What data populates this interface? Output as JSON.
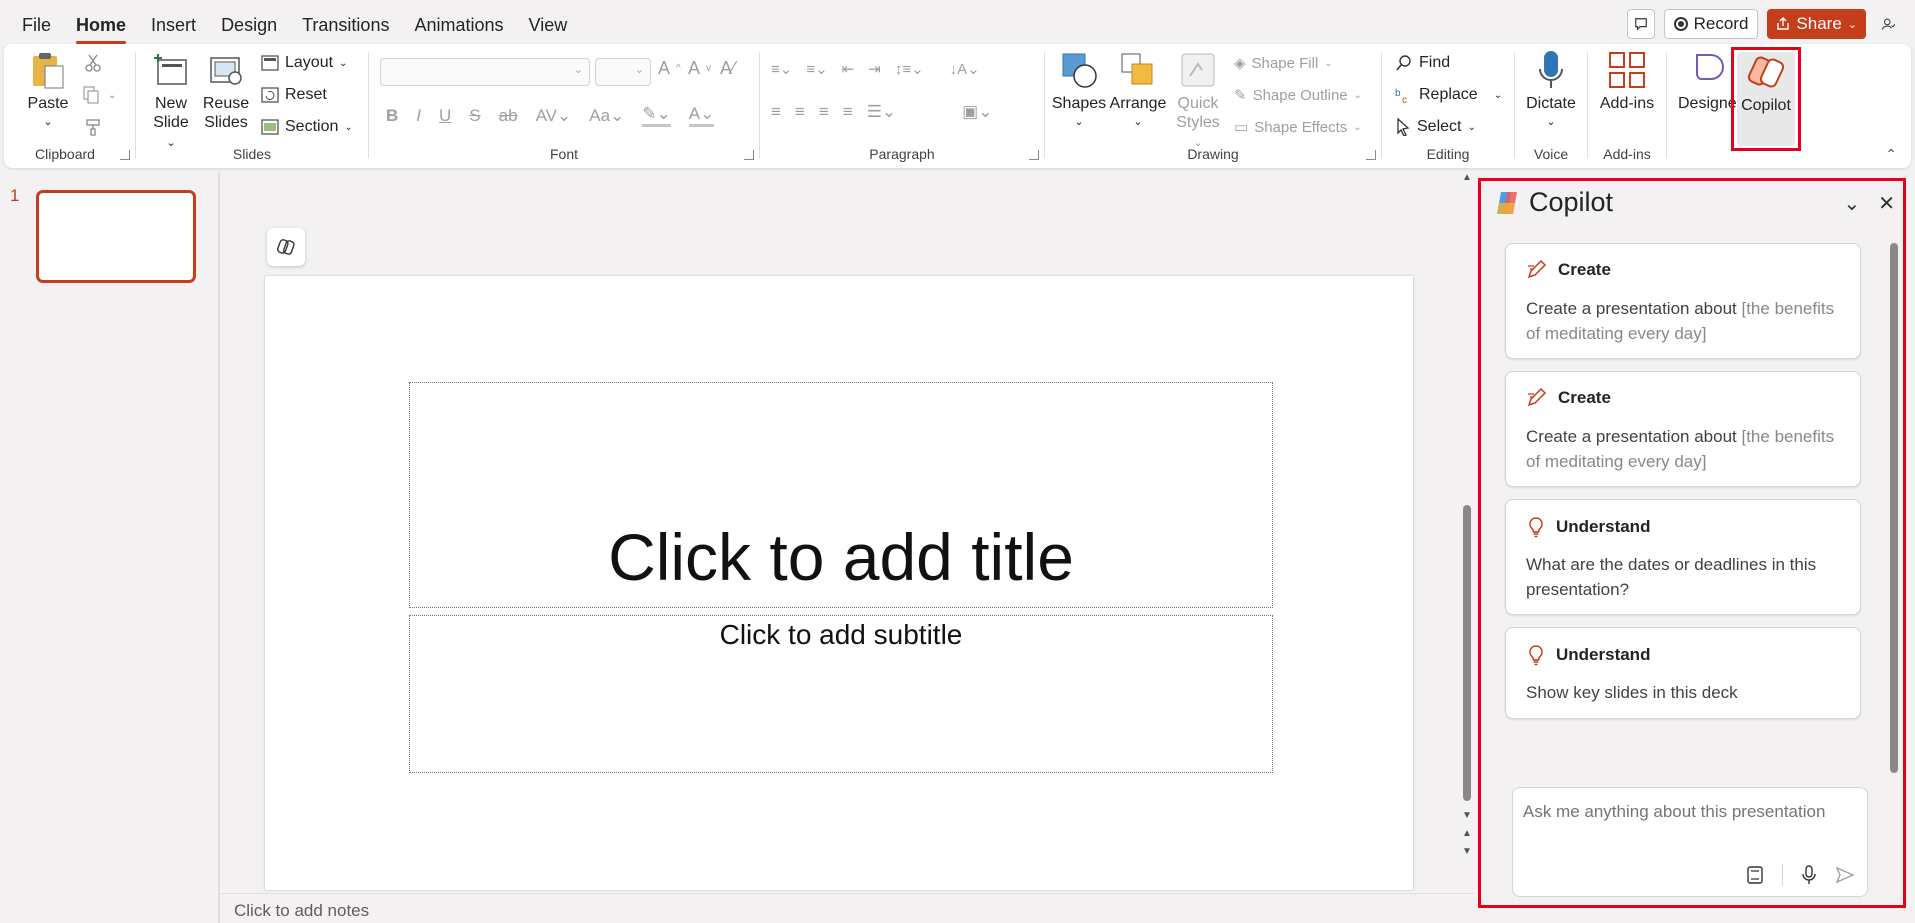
{
  "menu": {
    "tabs": [
      "File",
      "Home",
      "Insert",
      "Design",
      "Transitions",
      "Animations",
      "View"
    ],
    "active": "Home",
    "record_label": "Record",
    "share_label": "Share"
  },
  "ribbon": {
    "clipboard": {
      "paste": "Paste",
      "group": "Clipboard"
    },
    "slides": {
      "new_slide_1": "New",
      "new_slide_2": "Slide",
      "reuse_1": "Reuse",
      "reuse_2": "Slides",
      "layout": "Layout",
      "reset": "Reset",
      "section": "Section",
      "group": "Slides"
    },
    "font": {
      "group": "Font"
    },
    "paragraph": {
      "group": "Paragraph"
    },
    "drawing": {
      "shapes": "Shapes",
      "arrange": "Arrange",
      "quick_1": "Quick",
      "quick_2": "Styles",
      "shape_fill": "Shape Fill",
      "shape_outline": "Shape Outline",
      "shape_effects": "Shape Effects",
      "group": "Drawing"
    },
    "editing": {
      "find": "Find",
      "replace": "Replace",
      "select": "Select",
      "group": "Editing"
    },
    "voice": {
      "dictate": "Dictate",
      "group": "Voice"
    },
    "addins": {
      "addins": "Add-ins",
      "group": "Add-ins"
    },
    "designer": "Designer",
    "copilot": "Copilot"
  },
  "thumbnails": {
    "slide_number": "1"
  },
  "slide": {
    "title_placeholder": "Click to add title",
    "subtitle_placeholder": "Click to add subtitle"
  },
  "notes": {
    "placeholder": "Click to add notes"
  },
  "copilot_pane": {
    "title": "Copilot",
    "cards": [
      {
        "kind": "Create",
        "icon": "pen-sparkle-icon",
        "text": "Create a presentation about ",
        "muted": "[the benefits of meditating every day]"
      },
      {
        "kind": "Create",
        "icon": "pen-sparkle-icon",
        "text": "Create a presentation about ",
        "muted": "[the benefits of meditating every day]"
      },
      {
        "kind": "Understand",
        "icon": "lightbulb-icon",
        "text": "What are the dates or deadlines in this presentation?",
        "muted": ""
      },
      {
        "kind": "Understand",
        "icon": "lightbulb-icon",
        "text": "Show key slides in this deck",
        "muted": ""
      }
    ],
    "input_placeholder": "Ask me anything about this presentation"
  },
  "colors": {
    "accent": "#c43e1c",
    "highlight": "#e3001b"
  }
}
